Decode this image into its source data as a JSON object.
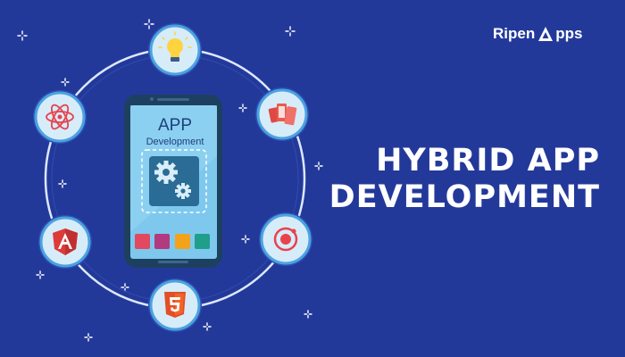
{
  "brand": {
    "name_part1": "Ripen",
    "name_part2": "pps",
    "logo_icon": "ripen-a-logo"
  },
  "headline": {
    "line1": "HYBRID APP",
    "line2": "DEVELOPMENT"
  },
  "phone": {
    "screen_title": "APP",
    "screen_subtitle": "Development",
    "app_tiles": [
      "#e2485e",
      "#b23a7e",
      "#f2a31b",
      "#1f9e8a"
    ]
  },
  "orbit_icons": [
    {
      "name": "lightbulb-icon"
    },
    {
      "name": "react-icon"
    },
    {
      "name": "phonegap-icon"
    },
    {
      "name": "angular-icon"
    },
    {
      "name": "ionic-icon"
    },
    {
      "name": "html5-icon"
    }
  ],
  "colors": {
    "background": "#23399a",
    "orbit_ring": "#dce8ff",
    "circle_fill": "#d7ecf9",
    "circle_border": "#4aa3df",
    "phone_body": "#1d4060",
    "phone_screen": "#7ec8ee",
    "gear": "#1f5270"
  }
}
